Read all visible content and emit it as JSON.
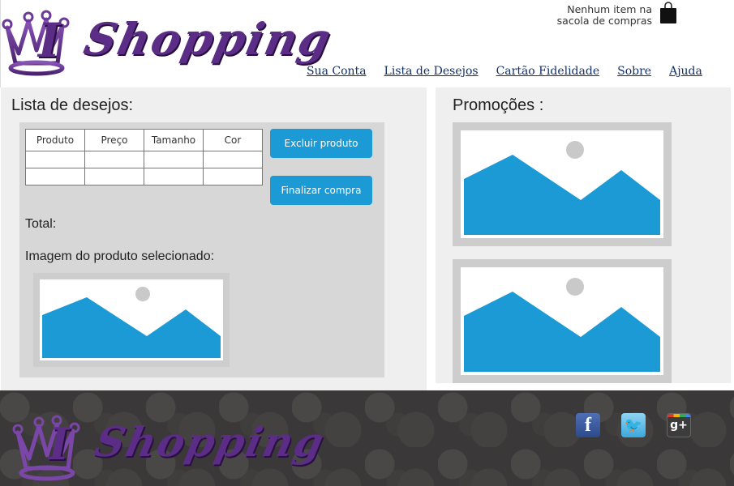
{
  "brand": {
    "logo_letter": "I",
    "logo_word": "Shopping",
    "accent_color": "#5b2d86",
    "crown_icon": "crown-icon"
  },
  "cart": {
    "status_text_line1": "Nenhum item na",
    "status_text_line2": "sacola de compras",
    "icon": "shopping-bag-icon"
  },
  "nav": {
    "items": [
      {
        "label": "Sua Conta"
      },
      {
        "label": "Lista de Desejos"
      },
      {
        "label": "Cartão Fidelidade"
      },
      {
        "label": "Sobre"
      },
      {
        "label": "Ajuda"
      }
    ]
  },
  "wishlist": {
    "title": "Lista de desejos:",
    "table": {
      "headers": [
        "Produto",
        "Preço",
        "Tamanho",
        "Cor"
      ],
      "rows": [
        [
          "",
          "",
          "",
          ""
        ],
        [
          "",
          "",
          "",
          ""
        ]
      ]
    },
    "delete_button": "Excluir produto",
    "checkout_button": "Finalizar compra",
    "total_label": "Total:",
    "selected_image_label": "Imagem do produto selecionado:",
    "button_color": "#1b9ad6"
  },
  "promotions": {
    "title": "Promoções :",
    "images": [
      {
        "icon": "image-placeholder-icon"
      },
      {
        "icon": "image-placeholder-icon"
      }
    ]
  },
  "footer": {
    "logo_letter": "I",
    "logo_word": "Shopping",
    "social": [
      {
        "icon": "facebook-icon",
        "glyph": "f"
      },
      {
        "icon": "twitter-icon",
        "glyph": "🐦"
      },
      {
        "icon": "google-plus-icon",
        "glyph": "g+"
      }
    ]
  }
}
